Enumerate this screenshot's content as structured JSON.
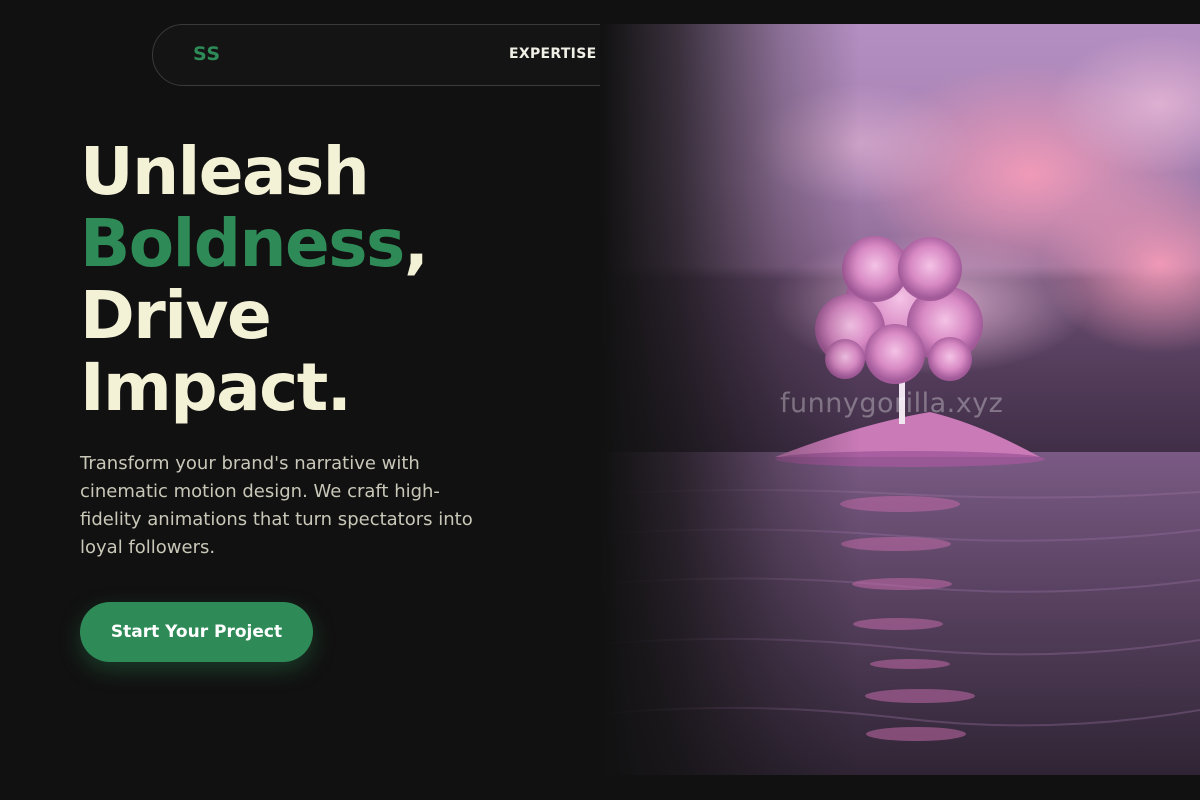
{
  "nav": {
    "logo": "SS",
    "links": [
      {
        "label": "EXPERTISE"
      }
    ]
  },
  "hero": {
    "headline": {
      "line1": "Unleash",
      "accent_word": "Boldness",
      "accent_punct": ",",
      "line3": "Drive",
      "line4": "Impact."
    },
    "description": "Transform your brand's narrative with cinematic motion design. We craft high-fidelity animations that turn spectators into loyal followers.",
    "cta_label": "Start Your Project",
    "image_watermark": "funnygorilla.xyz"
  },
  "colors": {
    "background": "#111111",
    "accent": "#2e8b57",
    "headline": "#f3f1d6",
    "body_text": "#c9c7b8"
  }
}
